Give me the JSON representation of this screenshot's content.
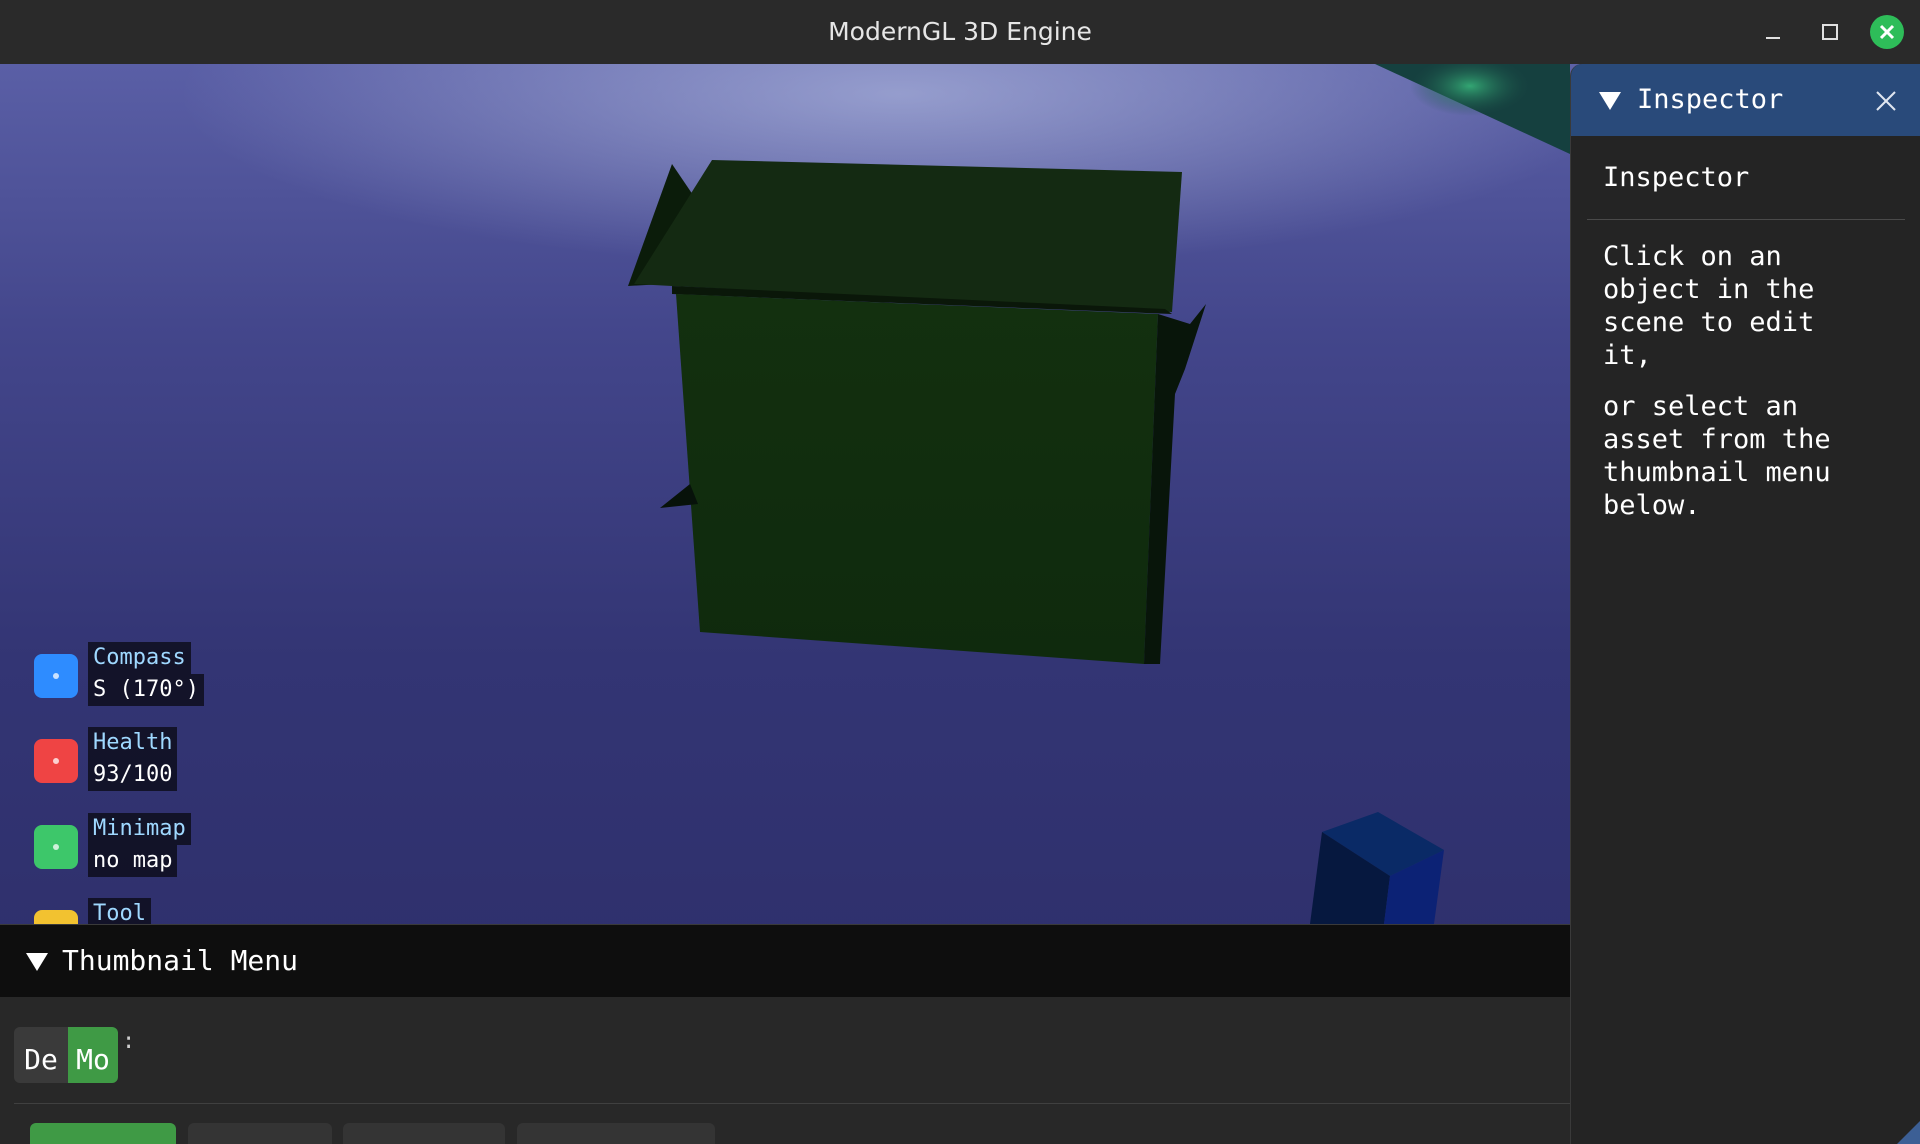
{
  "window": {
    "title": "ModernGL 3D Engine",
    "controls": {
      "minimize": "minimize-icon",
      "maximize": "maximize-icon",
      "close": "close-icon"
    },
    "close_color": "#2ebd59"
  },
  "hud": [
    {
      "key": "compass",
      "label": "Compass",
      "value": "S (170°)",
      "color": "#2e8cff"
    },
    {
      "key": "health",
      "label": "Health",
      "value": "93/100",
      "color": "#ef4444"
    },
    {
      "key": "minimap",
      "label": "Minimap",
      "value": "no map",
      "color": "#3dc76a"
    },
    {
      "key": "tool",
      "label": "Tool",
      "value": "",
      "color": "#f2c230"
    }
  ],
  "inspector": {
    "header": "Inspector",
    "subtitle": "Inspector",
    "paragraph1": "Click on an\nobject in the\nscene to edit\nit,",
    "paragraph2": "or select an\nasset from the\nthumbnail menu\nbelow.",
    "header_color": "#294a7a"
  },
  "thumbnail_menu": {
    "header": "Thumbnail Menu",
    "mode_buttons": [
      {
        "label": "De",
        "active": false
      },
      {
        "label": "Mo",
        "active": true
      }
    ],
    "separator_text": ":",
    "active_color": "#3f9a45"
  }
}
